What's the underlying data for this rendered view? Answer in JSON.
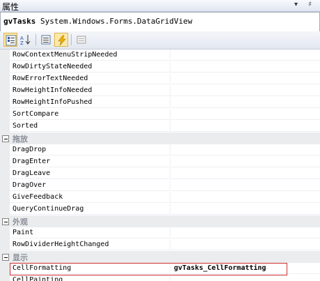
{
  "window": {
    "title": "属性",
    "buttons": "▾ ♯"
  },
  "object": {
    "name": "gvTasks",
    "type": "System.Windows.Forms.DataGridView"
  },
  "toolbar": {
    "buttons": [
      {
        "icon": "categorized-icon",
        "active": true
      },
      {
        "icon": "alphabetical-icon",
        "active": false
      },
      {
        "icon": "properties-icon",
        "active": false
      },
      {
        "icon": "events-icon",
        "active": true
      },
      {
        "icon": "property-pages-icon",
        "active": false
      }
    ]
  },
  "rows": [
    {
      "kind": "item",
      "label": "RowContextMenuStripNeeded",
      "value": ""
    },
    {
      "kind": "item",
      "label": "RowDirtyStateNeeded",
      "value": ""
    },
    {
      "kind": "item",
      "label": "RowErrorTextNeeded",
      "value": ""
    },
    {
      "kind": "item",
      "label": "RowHeightInfoNeeded",
      "value": ""
    },
    {
      "kind": "item",
      "label": "RowHeightInfoPushed",
      "value": ""
    },
    {
      "kind": "item",
      "label": "SortCompare",
      "value": ""
    },
    {
      "kind": "item",
      "label": "Sorted",
      "value": ""
    },
    {
      "kind": "category",
      "label": "拖放"
    },
    {
      "kind": "item",
      "label": "DragDrop",
      "value": ""
    },
    {
      "kind": "item",
      "label": "DragEnter",
      "value": ""
    },
    {
      "kind": "item",
      "label": "DragLeave",
      "value": ""
    },
    {
      "kind": "item",
      "label": "DragOver",
      "value": ""
    },
    {
      "kind": "item",
      "label": "GiveFeedback",
      "value": ""
    },
    {
      "kind": "item",
      "label": "QueryContinueDrag",
      "value": ""
    },
    {
      "kind": "category",
      "label": "外观"
    },
    {
      "kind": "item",
      "label": "Paint",
      "value": ""
    },
    {
      "kind": "item",
      "label": "RowDividerHeightChanged",
      "value": ""
    },
    {
      "kind": "category",
      "label": "显示"
    },
    {
      "kind": "item",
      "label": "CellFormatting",
      "value": "gvTasks_CellFormatting",
      "selected": true
    },
    {
      "kind": "item",
      "label": "CellPainting",
      "value": ""
    }
  ]
}
